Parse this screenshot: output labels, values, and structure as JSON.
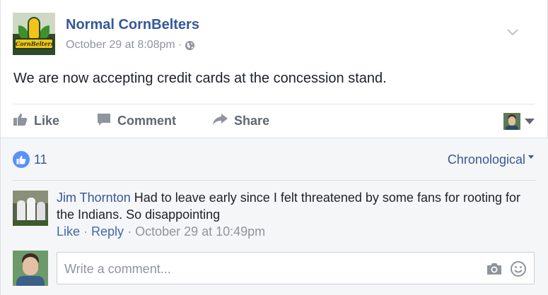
{
  "post": {
    "page_name": "Normal CornBelters",
    "logo_text": "CornBelters",
    "timestamp": "October 29 at 8:08pm",
    "separator": "·",
    "audience_icon": "globe-icon",
    "message": "We are now accepting credit cards at the concession stand."
  },
  "actions": {
    "like_label": "Like",
    "comment_label": "Comment",
    "share_label": "Share"
  },
  "reactions": {
    "icon": "like-icon",
    "count": "11",
    "sort_label": "Chronological"
  },
  "comment": {
    "author": "Jim Thornton",
    "text": " Had to leave early since I felt threatened by some fans for rooting for the Indians. So disappointing",
    "like_label": "Like",
    "reply_label": "Reply",
    "timestamp": "October 29 at 10:49pm",
    "separator": " · "
  },
  "composer": {
    "placeholder": "Write a comment..."
  },
  "colors": {
    "link": "#365899",
    "meta": "#90949c",
    "like_badge": "#5890ff",
    "comments_bg": "#f5f6f7"
  }
}
